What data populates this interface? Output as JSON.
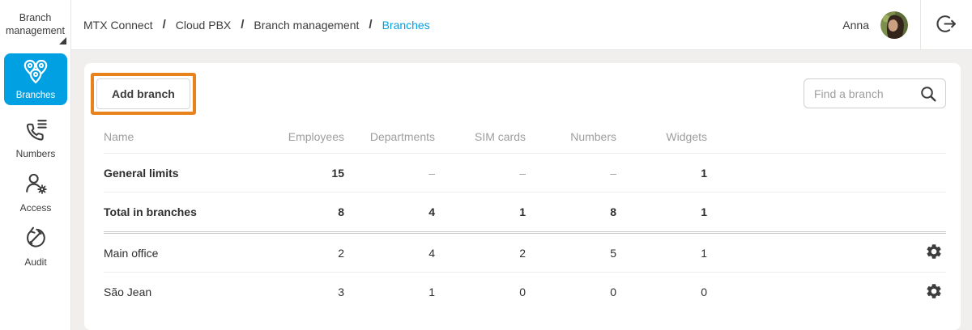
{
  "colors": {
    "accent_blue": "#00a0e3",
    "highlight_orange": "#e8821d"
  },
  "sidebar": {
    "title": "Branch management",
    "items": [
      {
        "label": "Branches",
        "icon": "branch-pins-icon",
        "active": true
      },
      {
        "label": "Numbers",
        "icon": "phone-list-icon",
        "active": false
      },
      {
        "label": "Access",
        "icon": "user-gear-icon",
        "active": false
      },
      {
        "label": "Audit",
        "icon": "pencil-circle-icon",
        "active": false
      }
    ]
  },
  "topbar": {
    "breadcrumbs": [
      "MTX Connect",
      "Cloud PBX",
      "Branch management",
      "Branches"
    ],
    "separator": "/",
    "user_name": "Anna"
  },
  "content": {
    "add_branch_label": "Add branch",
    "search_placeholder": "Find a branch",
    "table": {
      "headers": [
        "Name",
        "Employees",
        "Departments",
        "SIM cards",
        "Numbers",
        "Widgets"
      ],
      "summary_rows": [
        {
          "name": "General limits",
          "values": [
            "15",
            "–",
            "–",
            "–",
            "1"
          ]
        },
        {
          "name": "Total in branches",
          "values": [
            "8",
            "4",
            "1",
            "8",
            "1"
          ]
        }
      ],
      "branch_rows": [
        {
          "name": "Main office",
          "values": [
            "2",
            "4",
            "2",
            "5",
            "1"
          ]
        },
        {
          "name": "São Jean",
          "values": [
            "3",
            "1",
            "0",
            "0",
            "0"
          ]
        }
      ]
    }
  }
}
